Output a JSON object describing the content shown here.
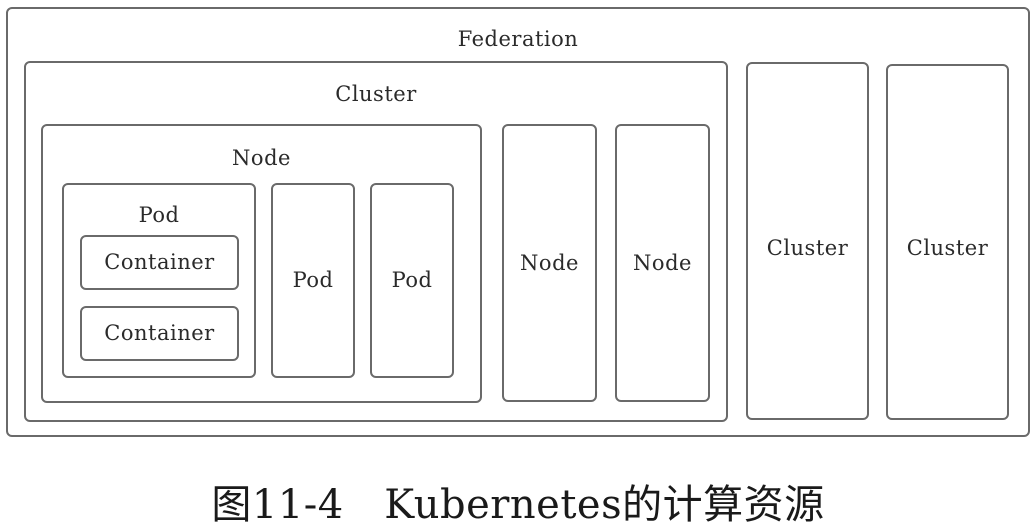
{
  "diagram": {
    "federation": {
      "label": "Federation"
    },
    "cluster_main": {
      "label": "Cluster"
    },
    "node_main": {
      "label": "Node"
    },
    "pod_main": {
      "label": "Pod"
    },
    "container_1": {
      "label": "Container"
    },
    "container_2": {
      "label": "Container"
    },
    "pod_2": {
      "label": "Pod"
    },
    "pod_3": {
      "label": "Pod"
    },
    "node_2": {
      "label": "Node"
    },
    "node_3": {
      "label": "Node"
    },
    "cluster_2": {
      "label": "Cluster"
    },
    "cluster_3": {
      "label": "Cluster"
    }
  },
  "caption": "图11-4　Kubernetes的计算资源"
}
